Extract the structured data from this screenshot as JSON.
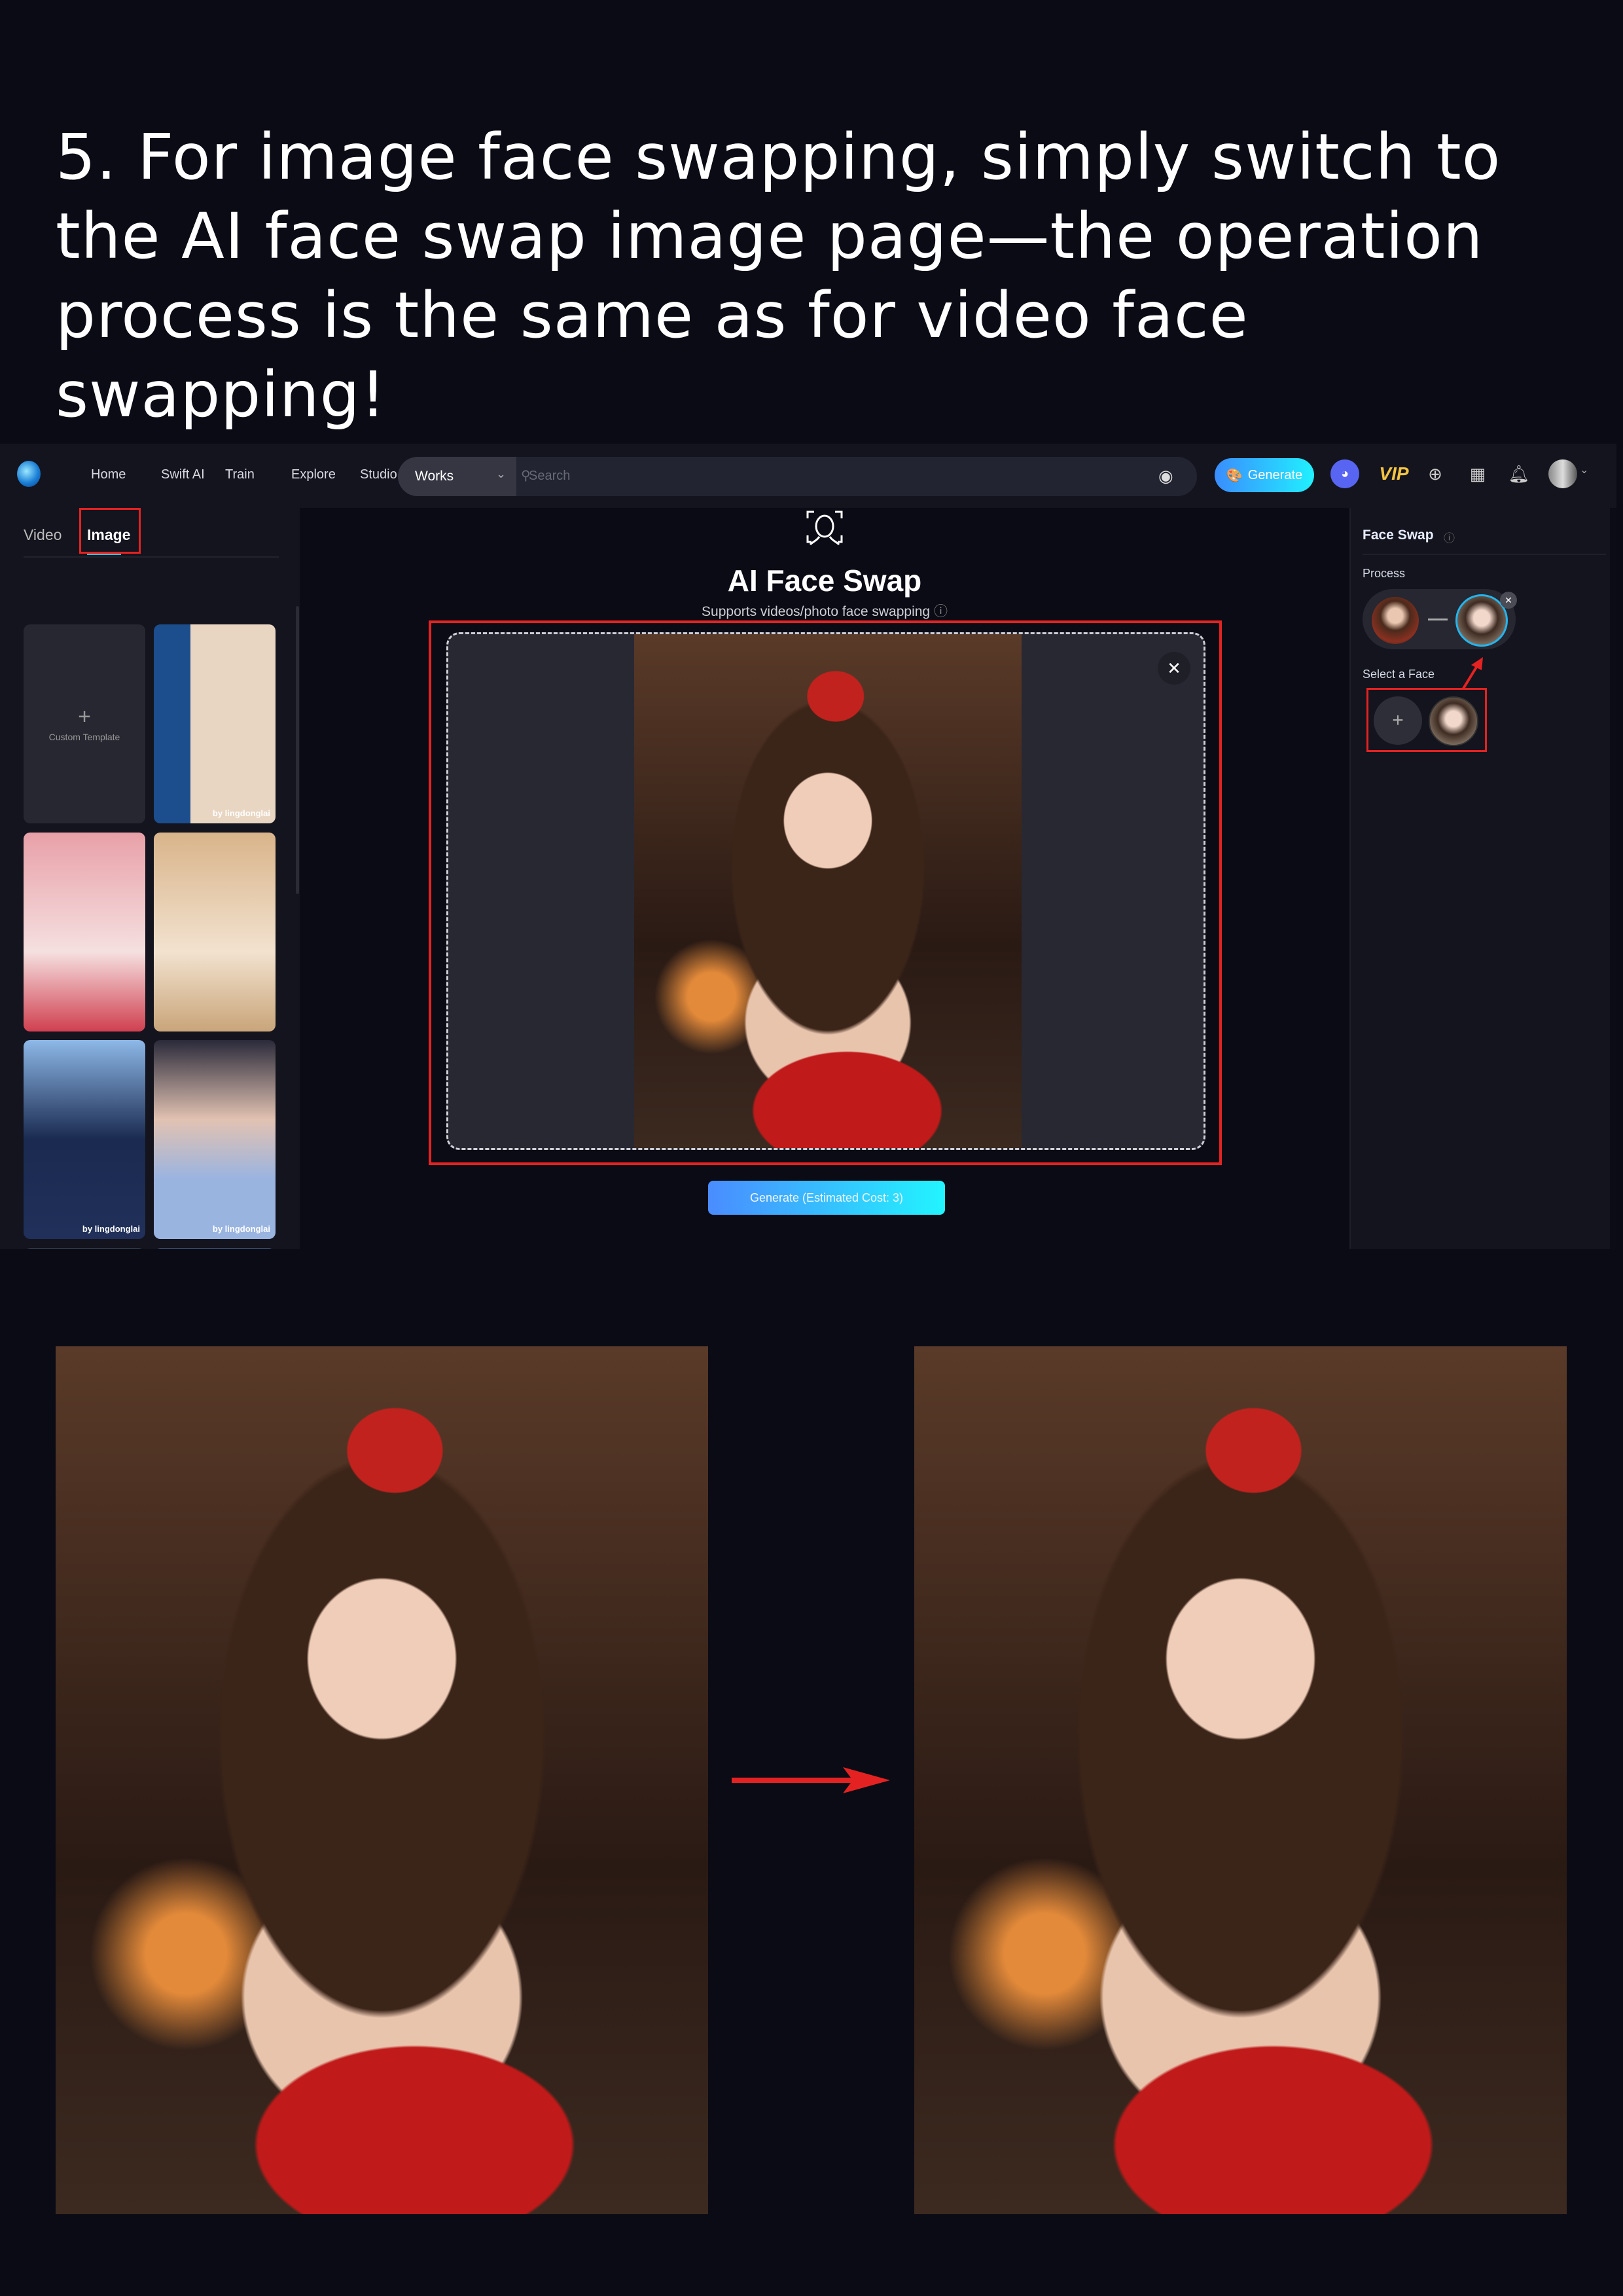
{
  "headline": "5. For image face swapping, simply switch to the AI face swap image page—the operation process is the same as for video face swapping!",
  "nav": {
    "links": [
      "Home",
      "Swift AI",
      "Train",
      "Explore",
      "Studio"
    ],
    "search_scope": "Works",
    "search_placeholder": "Search",
    "generate_label": "Generate",
    "vip_label": "VIP"
  },
  "sidebar": {
    "tabs": [
      "Video",
      "Image"
    ],
    "active_tab": "Image",
    "custom_template": "Custom Template",
    "thumbnails": [
      {
        "credit": "by lingdonglai"
      },
      {
        "credit": ""
      },
      {
        "credit": ""
      },
      {
        "credit": "by lingdonglai"
      },
      {
        "credit": "by lingdonglai"
      }
    ]
  },
  "center": {
    "title": "AI Face Swap",
    "subtitle": "Supports videos/photo face swapping",
    "generate_button": "Generate (Estimated Cost: 3)"
  },
  "right_panel": {
    "title": "Face Swap",
    "process_label": "Process",
    "select_label": "Select a Face"
  },
  "colors": {
    "highlight": "#e52222",
    "accent": "#22b6f0",
    "background": "#0b0b15"
  }
}
